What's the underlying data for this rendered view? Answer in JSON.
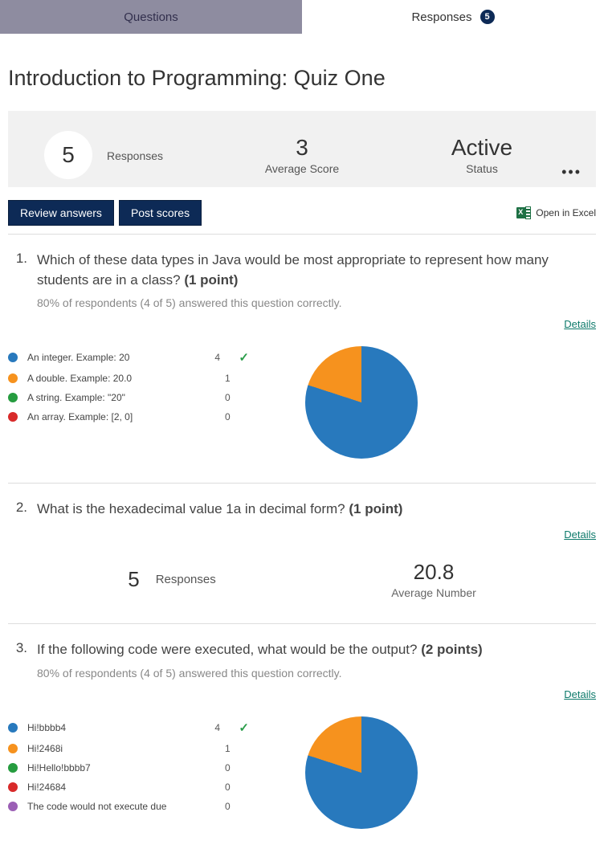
{
  "tabs": {
    "questions": "Questions",
    "responses": "Responses",
    "responses_count": "5"
  },
  "page_title": "Introduction to Programming: Quiz One",
  "summary": {
    "responses_value": "5",
    "responses_label": "Responses",
    "avg_value": "3",
    "avg_label": "Average Score",
    "status_value": "Active",
    "status_label": "Status"
  },
  "actions": {
    "review": "Review answers",
    "post": "Post scores",
    "open_excel": "Open in Excel"
  },
  "details_label": "Details",
  "colors": {
    "blue": "#2879bd",
    "orange": "#f6921e",
    "green": "#269c3f",
    "red": "#d82a2a",
    "purple": "#9b5fb5"
  },
  "questions": [
    {
      "number": "1.",
      "text": "Which of these data types in Java would be most appropriate to represent how many students are in a class? ",
      "points": "(1 point)",
      "subtext": "80% of respondents (4 of 5) answered this question correctly.",
      "type": "choice",
      "options": [
        {
          "label": "An integer. Example: 20",
          "count": "4",
          "correct": true,
          "color": "blue"
        },
        {
          "label": "A double. Example: 20.0",
          "count": "1",
          "correct": false,
          "color": "orange"
        },
        {
          "label": "A string. Example: \"20\"",
          "count": "0",
          "correct": false,
          "color": "green"
        },
        {
          "label": "An array. Example: [2, 0]",
          "count": "0",
          "correct": false,
          "color": "red"
        }
      ],
      "pie_gradient": "conic-gradient(from -72deg, #f6921e 0deg 72deg, #2879bd 72deg 360deg)"
    },
    {
      "number": "2.",
      "text": "What is the hexadecimal value 1a in decimal form? ",
      "points": "(1 point)",
      "type": "numeric",
      "numeric": {
        "responses_value": "5",
        "responses_label": "Responses",
        "avg_value": "20.8",
        "avg_label": "Average Number"
      }
    },
    {
      "number": "3.",
      "text": "If the following code were executed, what would be the output? ",
      "points": "(2 points)",
      "subtext": "80% of respondents (4 of 5) answered this question correctly.",
      "type": "choice",
      "options": [
        {
          "label": "Hi!bbbb4",
          "count": "4",
          "correct": true,
          "color": "blue"
        },
        {
          "label": "Hi!2468i",
          "count": "1",
          "correct": false,
          "color": "orange"
        },
        {
          "label": "Hi!Hello!bbbb7",
          "count": "0",
          "correct": false,
          "color": "green"
        },
        {
          "label": "Hi!24684",
          "count": "0",
          "correct": false,
          "color": "red"
        },
        {
          "label": "The code would not execute due",
          "count": "0",
          "correct": false,
          "color": "purple"
        }
      ],
      "pie_gradient": "conic-gradient(from -72deg, #f6921e 0deg 72deg, #2879bd 72deg 360deg)"
    }
  ],
  "chart_data": [
    {
      "type": "pie",
      "title": "Question 1 response distribution",
      "categories": [
        "An integer. Example: 20",
        "A double. Example: 20.0",
        "A string. Example: \"20\"",
        "An array. Example: [2, 0]"
      ],
      "values": [
        4,
        1,
        0,
        0
      ]
    },
    {
      "type": "pie",
      "title": "Question 3 response distribution",
      "categories": [
        "Hi!bbbb4",
        "Hi!2468i",
        "Hi!Hello!bbbb7",
        "Hi!24684",
        "The code would not execute due"
      ],
      "values": [
        4,
        1,
        0,
        0,
        0
      ]
    }
  ]
}
